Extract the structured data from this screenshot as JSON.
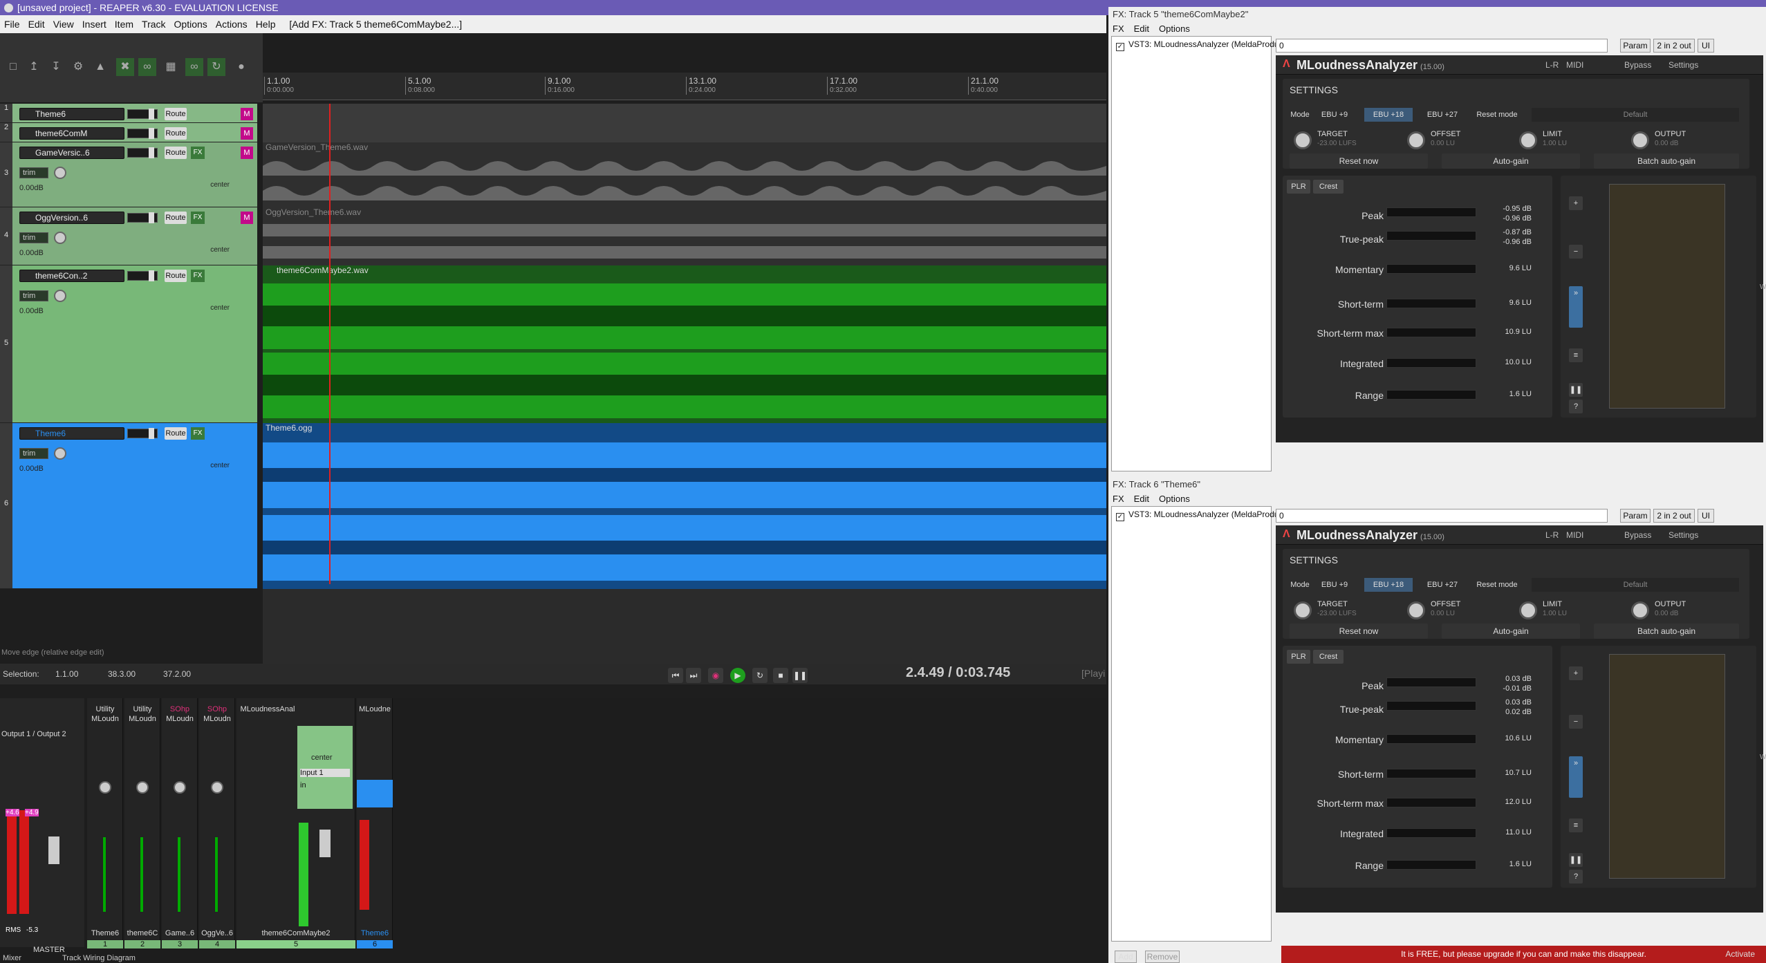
{
  "window": {
    "title": "[unsaved project] - REAPER v6.30 - EVALUATION LICENSE"
  },
  "menu": [
    "File",
    "Edit",
    "View",
    "Insert",
    "Item",
    "Track",
    "Options",
    "Actions",
    "Help"
  ],
  "menu_status": "[Add FX: Track 5 theme6ComMaybe2...]",
  "ruler": [
    {
      "bar": "1.1.00",
      "time": "0:00.000"
    },
    {
      "bar": "5.1.00",
      "time": "0:08.000"
    },
    {
      "bar": "9.1.00",
      "time": "0:16.000"
    },
    {
      "bar": "13.1.00",
      "time": "0:24.000"
    },
    {
      "bar": "17.1.00",
      "time": "0:32.000"
    },
    {
      "bar": "21.1.00",
      "time": "0:40.000"
    }
  ],
  "tracks": [
    {
      "num": "1",
      "name": "Theme6",
      "route": "Route"
    },
    {
      "num": "2",
      "name": "theme6ComM",
      "route": "Route"
    },
    {
      "num": "3",
      "name": "GameVersic..6",
      "route": "Route",
      "fx": "FX",
      "trim": "trim",
      "vol": "0.00dB",
      "pan": "center",
      "item": "GameVersion_Theme6.wav"
    },
    {
      "num": "4",
      "name": "OggVersion..6",
      "route": "Route",
      "fx": "FX",
      "trim": "trim",
      "vol": "0.00dB",
      "pan": "center",
      "item": "OggVersion_Theme6.wav"
    },
    {
      "num": "5",
      "name": "theme6Con..2",
      "route": "Route",
      "fx": "FX",
      "trim": "trim",
      "vol": "0.00dB",
      "pan": "center",
      "item": "theme6ComMaybe2.wav"
    },
    {
      "num": "6",
      "name": "Theme6",
      "route": "Route",
      "fx": "FX",
      "trim": "trim",
      "vol": "0.00dB",
      "pan": "center",
      "item": "Theme6.ogg"
    }
  ],
  "status": {
    "hint": "Move edge (relative edge edit)",
    "selection_label": "Selection:",
    "sel_start": "1.1.00",
    "sel_end": "38.3.00",
    "sel_len": "37.2.00",
    "position": "2.4.49 / 0:03.745",
    "play_state": "[Playi"
  },
  "mixer": {
    "output": "Output 1 / Output 2",
    "master_label": "MASTER",
    "rms": "RMS",
    "rms_val": "-5.3",
    "peak_l": "+4.6",
    "peak_r": "+4.9",
    "strips": [
      {
        "fx1": "Utility",
        "fx2": "MLoudn",
        "name": "Theme6",
        "num": "1"
      },
      {
        "fx1": "Utility",
        "fx2": "MLoudn",
        "name": "theme6C",
        "num": "2"
      },
      {
        "fx1": "SOhp",
        "fx2": "MLoudn",
        "name": "Game..6",
        "num": "3"
      },
      {
        "fx1": "SOhp",
        "fx2": "MLoudn",
        "name": "OggVe..6",
        "num": "4"
      }
    ],
    "wide_fx": "MLoudnessAnal",
    "wide_name": "theme6ComMaybe2",
    "wide_num": "5",
    "wide_pan": "center",
    "wide_input": "Input 1",
    "wide_in": "in",
    "last_fx": "MLoudne",
    "last_name": "Theme6",
    "last_num": "6",
    "tabs": [
      "Mixer",
      "Track Wiring Diagram"
    ]
  },
  "fx_windows": [
    {
      "title": "FX: Track 5 \"theme6ComMaybe2\"",
      "menu": [
        "FX",
        "Edit",
        "Options"
      ],
      "plugin": "VST3: MLoudnessAnalyzer (MeldaProdu...",
      "preset": "0",
      "param": "Param",
      "io": "2 in 2 out",
      "ui": "UI",
      "name": "MLoudnessAnalyzer",
      "version": "(15.00)",
      "header_btns": [
        "L-R",
        "MIDI",
        "Bypass",
        "Settings"
      ],
      "settings": "SETTINGS",
      "mode": "Mode",
      "ebu": [
        "EBU +9",
        "EBU +18",
        "EBU +27"
      ],
      "reset_mode": "Reset mode",
      "default": "Default",
      "target": "TARGET",
      "target_val": "-23.00 LUFS",
      "offset": "OFFSET",
      "offset_val": "0.00 LU",
      "limit": "LIMIT",
      "limit_val": "1.00 LU",
      "output": "OUTPUT",
      "output_val": "0.00 dB",
      "actions": [
        "Reset now",
        "Auto-gain",
        "Batch auto-gain"
      ],
      "tabs": [
        "PLR",
        "Crest"
      ],
      "rows": [
        {
          "label": "Peak",
          "v": "-0.95 dB",
          "v2": "-0.96 dB"
        },
        {
          "label": "True-peak",
          "v": "-0.87 dB",
          "v2": "-0.96 dB"
        },
        {
          "label": "Momentary",
          "v": "9.6 LU"
        },
        {
          "label": "Short-term",
          "v": "9.6 LU"
        },
        {
          "label": "Short-term max",
          "v": "10.9 LU"
        },
        {
          "label": "Integrated",
          "v": "10.0 LU"
        },
        {
          "label": "Range",
          "v": "1.6 LU"
        }
      ],
      "wav": "WAV"
    },
    {
      "title": "FX: Track 6 \"Theme6\"",
      "menu": [
        "FX",
        "Edit",
        "Options"
      ],
      "plugin": "VST3: MLoudnessAnalyzer (MeldaProdu...",
      "preset": "0",
      "param": "Param",
      "io": "2 in 2 out",
      "ui": "UI",
      "name": "MLoudnessAnalyzer",
      "version": "(15.00)",
      "header_btns": [
        "L-R",
        "MIDI",
        "Bypass",
        "Settings"
      ],
      "settings": "SETTINGS",
      "mode": "Mode",
      "ebu": [
        "EBU +9",
        "EBU +18",
        "EBU +27"
      ],
      "reset_mode": "Reset mode",
      "default": "Default",
      "target": "TARGET",
      "target_val": "-23.00 LUFS",
      "offset": "OFFSET",
      "offset_val": "0.00 LU",
      "limit": "LIMIT",
      "limit_val": "1.00 LU",
      "output": "OUTPUT",
      "output_val": "0.00 dB",
      "actions": [
        "Reset now",
        "Auto-gain",
        "Batch auto-gain"
      ],
      "tabs": [
        "PLR",
        "Crest"
      ],
      "rows": [
        {
          "label": "Peak",
          "v": "0.03 dB",
          "v2": "-0.01 dB"
        },
        {
          "label": "True-peak",
          "v": "0.03 dB",
          "v2": "0.02 dB"
        },
        {
          "label": "Momentary",
          "v": "10.6 LU"
        },
        {
          "label": "Short-term",
          "v": "10.7 LU"
        },
        {
          "label": "Short-term max",
          "v": "12.0 LU"
        },
        {
          "label": "Integrated",
          "v": "11.0 LU"
        },
        {
          "label": "Range",
          "v": "1.6 LU"
        }
      ],
      "wav": "WAV"
    }
  ],
  "fx_bottom": {
    "add": "Add",
    "remove": "Remove",
    "banner": "It is FREE, but please upgrade if you can and make this disappear.",
    "activate": "Activate"
  },
  "colors": {
    "title": "#6a5bb5",
    "track_green": "#78b878",
    "wave_green": "#1e9e1e",
    "wave_blue": "#2a8ff0",
    "arm": "#c20a8a",
    "banner": "#b41c1c"
  }
}
